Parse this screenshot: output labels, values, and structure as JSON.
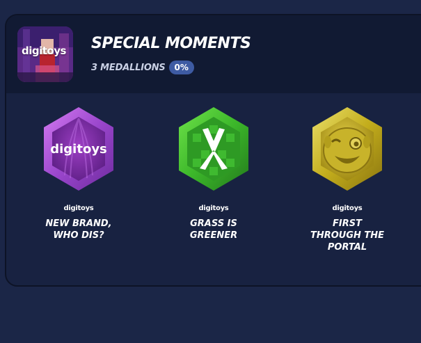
{
  "collection": {
    "thumbnail_label": "digitoys",
    "title": "SPECIAL MOMENTS",
    "count_label": "3 MEDALLIONS",
    "progress_label": "0%",
    "progress": 0
  },
  "medallions": [
    {
      "brand": "digitoys",
      "emblem_text": "digitoys",
      "name": "NEW BRAND,\nWHO DIS?",
      "color": "#a04fd4",
      "icon": "digitoys-logo-icon"
    },
    {
      "brand": "digitoys",
      "name": "GRASS IS\nGREENER",
      "color": "#3fc42c",
      "icon": "claw-emblem-icon"
    },
    {
      "brand": "digitoys",
      "name": "FIRST\nTHROUGH THE\nPORTAL",
      "color": "#c9b41e",
      "icon": "winking-face-icon"
    }
  ]
}
